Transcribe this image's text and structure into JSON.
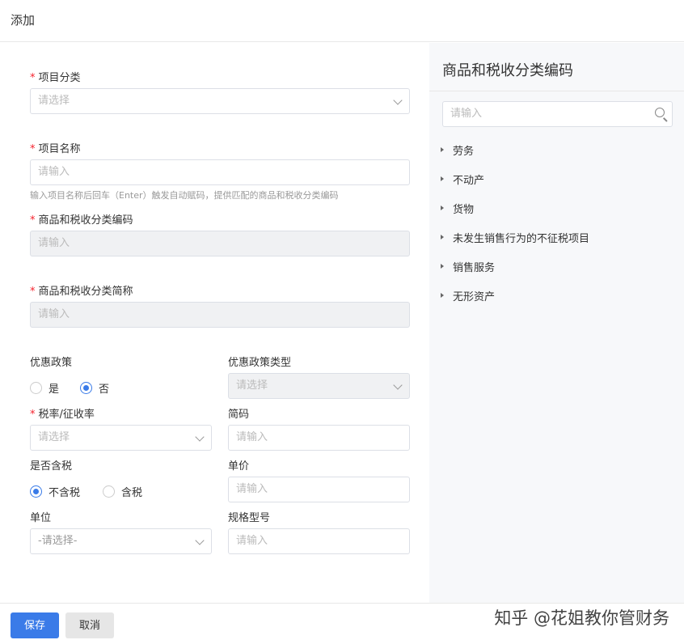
{
  "header": {
    "title": "添加"
  },
  "form": {
    "category": {
      "label": "项目分类",
      "placeholder": "请选择"
    },
    "name": {
      "label": "项目名称",
      "placeholder": "请输入",
      "hint": "输入项目名称后回车（Enter）触发自动赋码，提供匹配的商品和税收分类编码"
    },
    "tax_code": {
      "label": "商品和税收分类编码",
      "placeholder": "请输入"
    },
    "tax_short": {
      "label": "商品和税收分类简称",
      "placeholder": "请输入"
    },
    "preferential": {
      "label": "优惠政策",
      "options": [
        "是",
        "否"
      ],
      "selected": "否"
    },
    "preferential_type": {
      "label": "优惠政策类型",
      "placeholder": "请选择"
    },
    "tax_rate": {
      "label": "税率/征收率",
      "placeholder": "请选择"
    },
    "short_code": {
      "label": "简码",
      "placeholder": "请输入"
    },
    "tax_included": {
      "label": "是否含税",
      "options": [
        "不含税",
        "含税"
      ],
      "selected": "不含税"
    },
    "unit_price": {
      "label": "单价",
      "placeholder": "请输入"
    },
    "unit": {
      "label": "单位",
      "placeholder": "-请选择-"
    },
    "spec": {
      "label": "规格型号",
      "placeholder": "请输入"
    }
  },
  "panel": {
    "title": "商品和税收分类编码",
    "search_placeholder": "请输入",
    "items": [
      "劳务",
      "不动产",
      "货物",
      "未发生销售行为的不征税项目",
      "销售服务",
      "无形资产"
    ]
  },
  "footer": {
    "save": "保存",
    "cancel": "取消",
    "watermark": "知乎 @花姐教你管财务"
  }
}
